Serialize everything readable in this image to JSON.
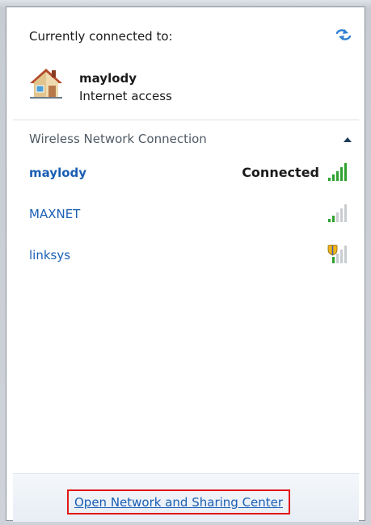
{
  "current": {
    "title": "Currently connected to:",
    "network_name": "maylody",
    "access": "Internet access"
  },
  "section": {
    "title": "Wireless Network Connection"
  },
  "networks": [
    {
      "name": "maylody",
      "status": "Connected",
      "secured": false
    },
    {
      "name": "MAXNET",
      "status": "",
      "secured": false
    },
    {
      "name": "linksys",
      "status": "",
      "secured": true
    }
  ],
  "footer": {
    "link_label": "Open Network and Sharing Center"
  },
  "colors": {
    "link_blue": "#1a5fb4",
    "signal_green": "#2ea12e",
    "highlight_red": "#e11717"
  },
  "icons": {
    "refresh": "refresh-icon",
    "house": "house-icon",
    "collapse": "chevron-up-icon",
    "signal": "signal-bars-icon",
    "shield": "shield-icon"
  }
}
